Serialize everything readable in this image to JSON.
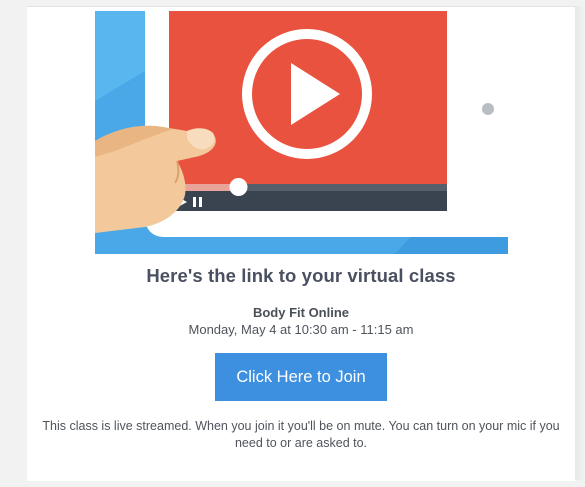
{
  "email": {
    "heading": "Here's the link to your virtual class",
    "class_name": "Body Fit Online",
    "class_time": "Monday, May 4 at 10:30 am - 11:15 am",
    "join_button_label": "Click Here to Join",
    "note": "This class is live streamed. When you join it you'll be on mute. You can turn on your mic if you need to or are asked to."
  },
  "hero": {
    "video_progress": 0.25
  },
  "colors": {
    "hero_background": "#4aa8e8",
    "tablet_frame": "#ffffff",
    "video_screen": "#e8523e",
    "control_bar": "#3a4450",
    "progress_fill": "#e9a49a",
    "button": "#3d8fe0",
    "heading_text": "#4a5060"
  },
  "icons": [
    "play-icon",
    "pause-icon",
    "hand-illustration",
    "tablet-illustration"
  ]
}
